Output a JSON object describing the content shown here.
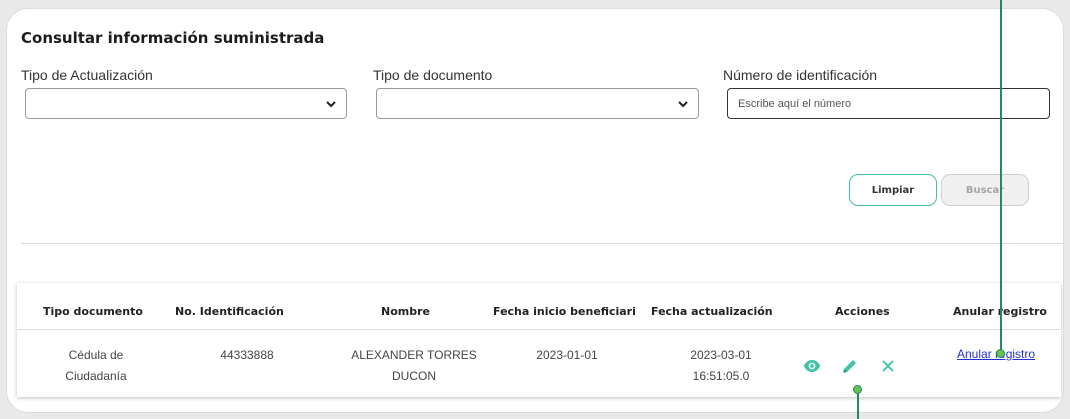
{
  "form": {
    "title": "Consultar información suministrada",
    "tipo_actualizacion": {
      "label": "Tipo de Actualización",
      "value": ""
    },
    "tipo_documento": {
      "label": "Tipo de documento",
      "value": ""
    },
    "numero_identificacion": {
      "label": "Número de identificación",
      "placeholder": "Escribe aquí el número"
    },
    "buttons": {
      "clear": "Limpiar",
      "search": "Buscar"
    }
  },
  "table": {
    "headers": [
      "Tipo documento",
      "No. Identificación",
      "Nombre",
      "Fecha inicio beneficiari",
      "Fecha actualización",
      "Acciones",
      "Anular registro"
    ],
    "rows": [
      {
        "tipo_documento": "Cédula de Ciudadanía",
        "identificacion": "44333888",
        "nombre": "ALEXANDER TORRES DUCON",
        "fecha_inicio": "2023-01-01",
        "fecha_actualizacion": "2023-03-01 16:51:05.0",
        "anular": "Anular registro",
        "actions": [
          "eye-icon",
          "pencil-icon",
          "close-icon"
        ]
      }
    ]
  },
  "colors": {
    "accent": "#3fc3a6",
    "link": "#2233cc",
    "pointer": "#1f8a63"
  }
}
